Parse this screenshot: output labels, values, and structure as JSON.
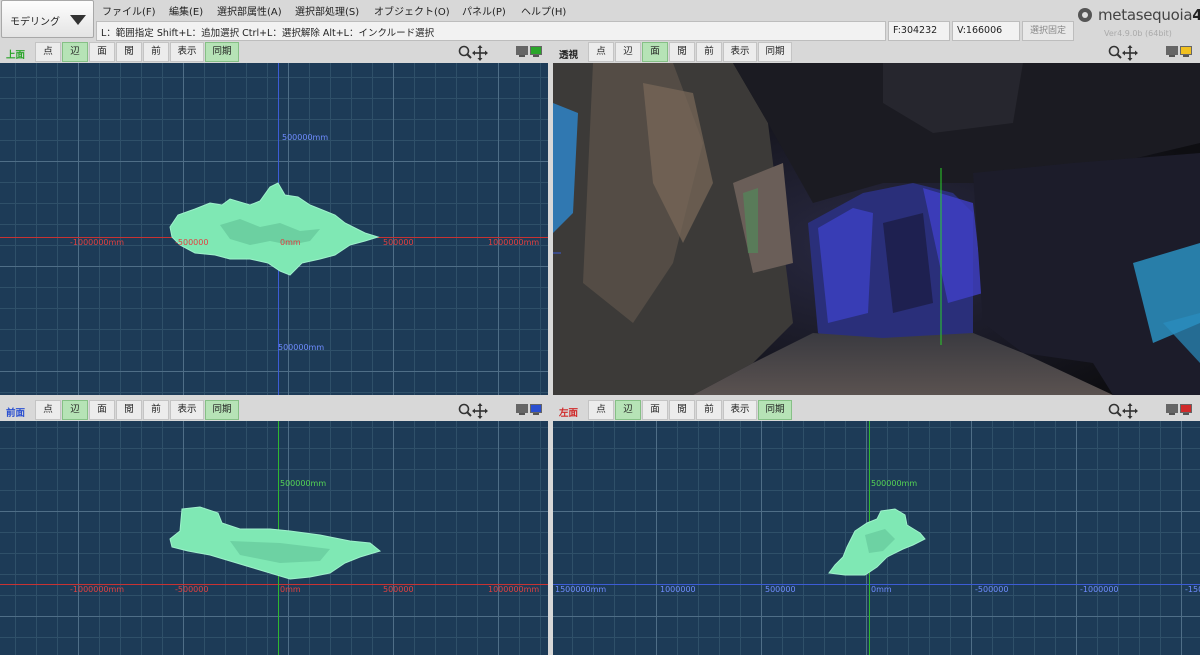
{
  "app": {
    "mode_label": "モデリング",
    "menus": [
      "ファイル(F)",
      "編集(E)",
      "選択部属性(A)",
      "選択部処理(S)",
      "オブジェクト(O)",
      "パネル(P)",
      "ヘルプ(H)"
    ],
    "hint": "L：範囲指定  Shift+L：追加選択  Ctrl+L：選択解除  Alt+L：インクルード選択",
    "face_count": "F:304232",
    "vertex_count": "V:166006",
    "fix_selection_label": "選択固定",
    "logo_text": "metasequoia",
    "logo_num": "4",
    "version": "Ver4.9.0b (64bit)"
  },
  "toolbar_buttons": [
    "点",
    "辺",
    "面",
    "閲",
    "前",
    "表示",
    "同期"
  ],
  "viewports": {
    "top": {
      "title": "上面",
      "title_color": "#2aa52a",
      "active_buttons": [
        "辺",
        "同期"
      ],
      "labels": {
        "y_pos": "500000mm",
        "y_neg": "500000mm",
        "x_neg_far": "-1000000mm",
        "x_neg_near": "-500000",
        "origin": "0mm",
        "x_pos_near": "500000",
        "x_pos_far": "1000000mm"
      }
    },
    "perspective": {
      "title": "透視",
      "title_color": "#222222",
      "active_buttons": [
        "面"
      ]
    },
    "front": {
      "title": "前面",
      "title_color": "#2a4fd0",
      "active_buttons": [
        "辺",
        "同期"
      ],
      "labels": {
        "y_pos": "500000mm",
        "x_neg_far": "-1000000mm",
        "x_neg_near": "-500000",
        "origin": "0mm",
        "x_pos_near": "500000",
        "x_pos_far": "1000000mm"
      }
    },
    "left": {
      "title": "左面",
      "title_color": "#d02a2a",
      "active_buttons": [
        "辺",
        "同期"
      ],
      "labels": {
        "y_pos": "500000mm",
        "z_far_left": "1500000mm",
        "z_1": "1000000",
        "z_2": "500000",
        "origin": "0mm",
        "z_3": "-500000",
        "z_4": "-1000000",
        "z_5": "-150"
      }
    }
  },
  "colors": {
    "grid_bg": "#1d3b57",
    "mesh": "#7fe8b4",
    "axis_x": "#c83232",
    "axis_y": "#3c5cd6",
    "axis_z": "#2fb82f"
  }
}
